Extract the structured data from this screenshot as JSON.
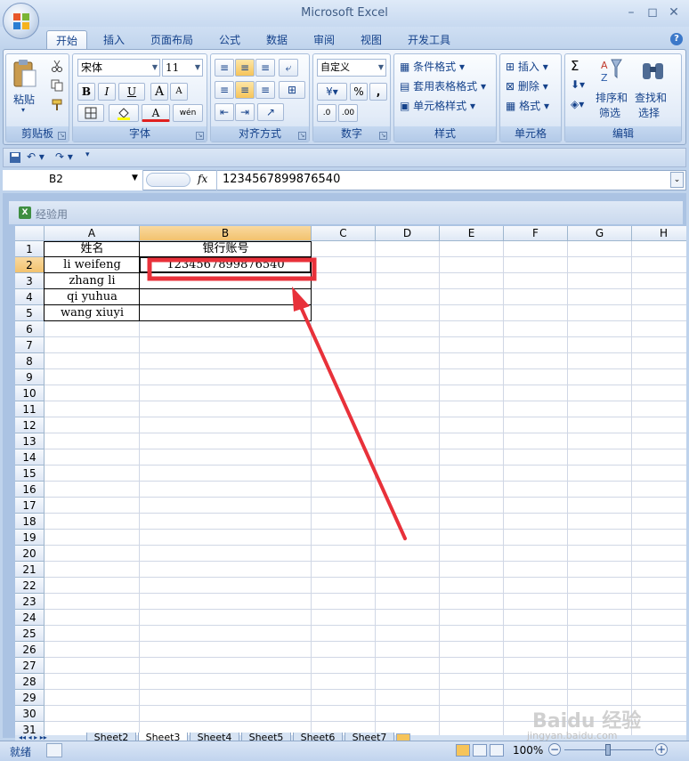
{
  "window": {
    "title": "Microsoft Excel",
    "controls": {
      "minimize": "–",
      "restore": "◻",
      "close": "✕"
    }
  },
  "ribbon_tabs": [
    {
      "label": "开始",
      "active": true
    },
    {
      "label": "插入"
    },
    {
      "label": "页面布局"
    },
    {
      "label": "公式"
    },
    {
      "label": "数据"
    },
    {
      "label": "审阅"
    },
    {
      "label": "视图"
    },
    {
      "label": "开发工具"
    }
  ],
  "clipboard": {
    "paste_label": "粘贴",
    "group_label": "剪贴板"
  },
  "font_group": {
    "font_name": "宋体",
    "font_size": "11",
    "bold": "B",
    "italic": "I",
    "underline": "U",
    "grow": "A",
    "shrink": "A",
    "font_color_glyph": "A",
    "phonetic": "wén",
    "group_label": "字体"
  },
  "alignment": {
    "group_label": "对齐方式"
  },
  "number": {
    "format": "自定义",
    "percent": "%",
    "comma": ",",
    "group_label": "数字"
  },
  "styles": {
    "conditional": "条件格式",
    "table": "套用表格格式",
    "cell_style": "单元格样式",
    "group_label": "样式"
  },
  "cells_group": {
    "insert": "插入",
    "delete": "删除",
    "format": "格式",
    "group_label": "单元格"
  },
  "editing": {
    "sum": "Σ",
    "sort_filter_1": "排序和",
    "sort_filter_2": "筛选",
    "find_select_1": "查找和",
    "find_select_2": "选择",
    "group_label": "编辑"
  },
  "formula_bar": {
    "name_box": "B2",
    "fx": "fx",
    "formula": "1234567899876540"
  },
  "workbook_title": "经验用",
  "columns": [
    "A",
    "B",
    "C",
    "D",
    "E",
    "F",
    "G",
    "H"
  ],
  "rows": [
    "1",
    "2",
    "3",
    "4",
    "5",
    "6",
    "7",
    "8",
    "9",
    "10",
    "11",
    "12",
    "13",
    "14",
    "15",
    "16",
    "17",
    "18",
    "19",
    "20",
    "21",
    "22",
    "23",
    "24",
    "25",
    "26",
    "27",
    "28",
    "29",
    "30",
    "31"
  ],
  "cells": {
    "A1": "姓名",
    "B1": "银行账号",
    "A2": "li weifeng",
    "B2": "1234567899876540",
    "A3": "zhang li",
    "A4": "qi yuhua",
    "A5": "wang xiuyi"
  },
  "sheet_tabs": [
    "Sheet2",
    "Sheet3",
    "Sheet4",
    "Sheet5",
    "Sheet6",
    "Sheet7"
  ],
  "status": {
    "ready": "就绪",
    "zoom": "100%",
    "minus": "−",
    "plus": "+"
  },
  "watermark": {
    "text": "Baidu 经验",
    "url": "jingyan.baidu.com"
  },
  "colors": {
    "annotation": "#e8313a",
    "select_header": "#f2c26e"
  }
}
